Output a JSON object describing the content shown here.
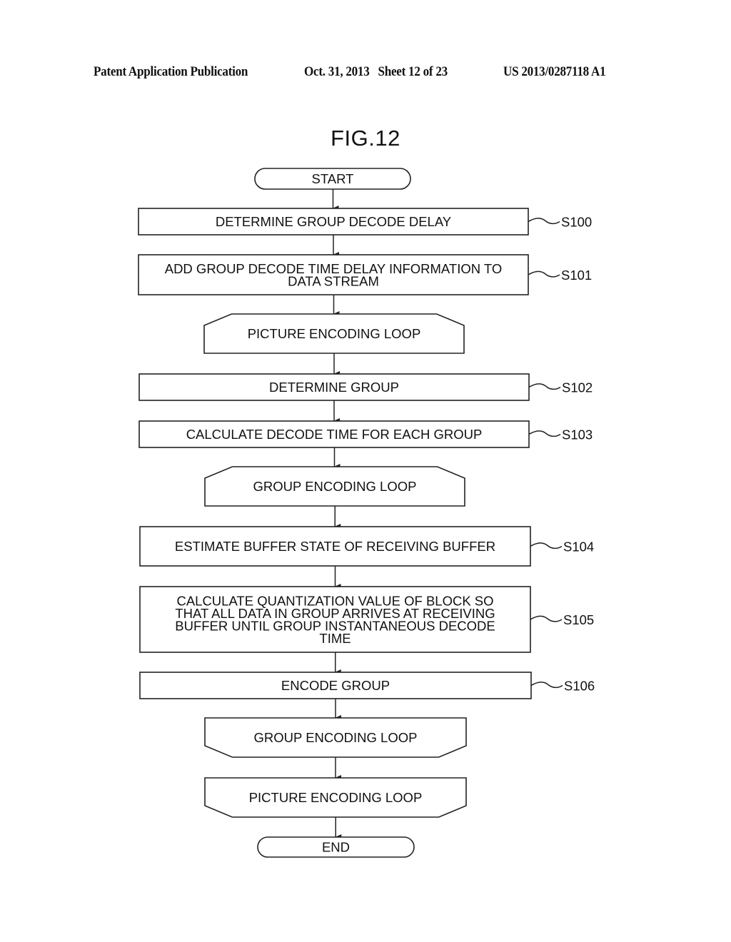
{
  "header": {
    "publication": "Patent Application Publication",
    "date_sheet": "Oct. 31, 2013   Sheet 12 of 23",
    "number": "US 2013/0287118 A1"
  },
  "figure": {
    "title": "FIG.12"
  },
  "flowchart": {
    "nodes": [
      {
        "id": "start",
        "type": "terminal",
        "lines": [
          "START"
        ],
        "step": ""
      },
      {
        "id": "s100",
        "type": "process",
        "lines": [
          "DETERMINE GROUP DECODE DELAY"
        ],
        "step": "S100"
      },
      {
        "id": "s101",
        "type": "process",
        "lines": [
          "ADD GROUP DECODE TIME DELAY INFORMATION TO",
          "DATA STREAM"
        ],
        "step": "S101"
      },
      {
        "id": "picture-loop-start",
        "type": "loop-start",
        "lines": [
          "PICTURE ENCODING LOOP"
        ],
        "step": ""
      },
      {
        "id": "s102",
        "type": "process",
        "lines": [
          "DETERMINE GROUP"
        ],
        "step": "S102"
      },
      {
        "id": "s103",
        "type": "process",
        "lines": [
          "CALCULATE DECODE TIME FOR EACH GROUP"
        ],
        "step": "S103"
      },
      {
        "id": "group-loop-start",
        "type": "loop-start",
        "lines": [
          "GROUP ENCODING LOOP"
        ],
        "step": ""
      },
      {
        "id": "s104",
        "type": "process",
        "lines": [
          "ESTIMATE BUFFER STATE OF RECEIVING BUFFER"
        ],
        "step": "S104"
      },
      {
        "id": "s105",
        "type": "process",
        "lines": [
          "CALCULATE QUANTIZATION VALUE OF BLOCK SO",
          "THAT ALL DATA IN GROUP ARRIVES AT RECEIVING",
          "BUFFER UNTIL GROUP INSTANTANEOUS DECODE",
          "TIME"
        ],
        "step": "S105"
      },
      {
        "id": "s106",
        "type": "process",
        "lines": [
          "ENCODE GROUP"
        ],
        "step": "S106"
      },
      {
        "id": "group-loop-end",
        "type": "loop-end",
        "lines": [
          "GROUP ENCODING LOOP"
        ],
        "step": ""
      },
      {
        "id": "picture-loop-end",
        "type": "loop-end",
        "lines": [
          "PICTURE ENCODING LOOP"
        ],
        "step": ""
      },
      {
        "id": "end",
        "type": "terminal",
        "lines": [
          "END"
        ],
        "step": ""
      }
    ]
  }
}
